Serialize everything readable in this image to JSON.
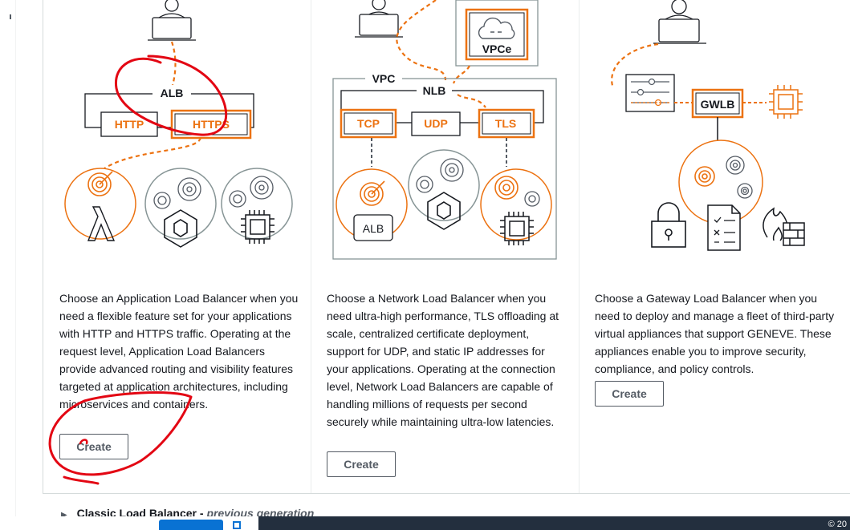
{
  "alb": {
    "description": "Choose an Application Load Balancer when you need a flexible feature set for your applications with HTTP and HTTPS traffic. Operating at the request level, Application Load Balancers provide advanced routing and visibility features targeted at application architectures, including microservices and containers.",
    "create_label": "Create",
    "diagram": {
      "lb": "ALB",
      "http": "HTTP",
      "https": "HTTPS"
    }
  },
  "nlb": {
    "description": "Choose a Network Load Balancer when you need ultra-high performance, TLS offloading at scale, centralized certificate deployment, support for UDP, and static IP addresses for your applications. Operating at the connection level, Network Load Balancers are capable of handling millions of requests per second securely while maintaining ultra-low latencies.",
    "create_label": "Create",
    "diagram": {
      "vpc": "VPC",
      "vpce": "VPCe",
      "lb": "NLB",
      "tcp": "TCP",
      "udp": "UDP",
      "tls": "TLS",
      "alb": "ALB"
    }
  },
  "gwlb": {
    "description": "Choose a Gateway Load Balancer when you need to deploy and manage a fleet of third-party virtual appliances that support GENEVE. These appliances enable you to improve security, compliance, and policy controls.",
    "create_label": "Create",
    "diagram": {
      "lb": "GWLB"
    }
  },
  "classic": {
    "label": "Classic Load Balancer",
    "suffix": "previous generation"
  },
  "footer": {
    "copyright": "© 20"
  },
  "colors": {
    "accent": "#ec7211",
    "text": "#16191f",
    "button": "#545b64",
    "footer": "#232f3e",
    "annotation": "#e30613"
  },
  "icons": [
    "user-laptop-icon",
    "target-icon",
    "lambda-icon",
    "container-icon",
    "chip-icon",
    "cloud-icon",
    "appliance-icon",
    "lock-icon",
    "checklist-icon",
    "firewall-icon",
    "chevron-right-icon"
  ]
}
